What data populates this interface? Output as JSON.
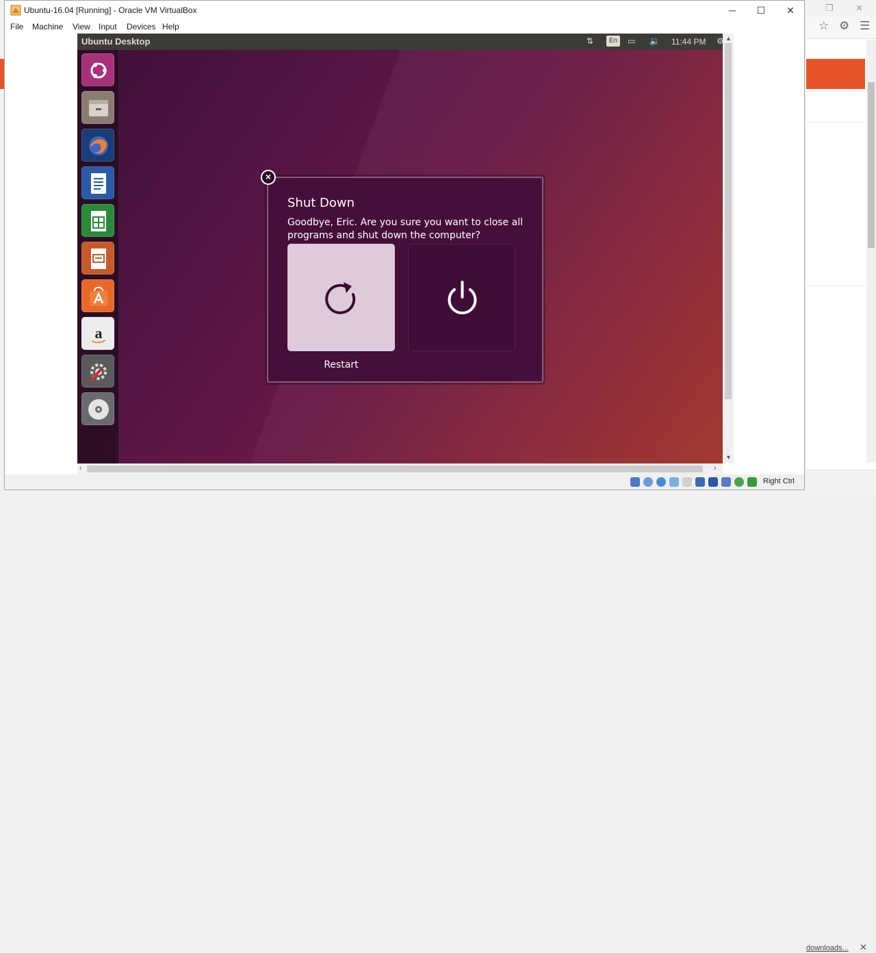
{
  "window": {
    "title": "Ubuntu-16.04 [Running] - Oracle VM VirtualBox",
    "minimize": "─",
    "maximize": "☐",
    "close": "✕"
  },
  "menu": [
    "File",
    "Machine",
    "View",
    "Input",
    "Devices",
    "Help"
  ],
  "guest": {
    "topbar_title": "Ubuntu Desktop",
    "language": "En",
    "clock": "11:44 PM",
    "launcher": [
      "ubuntu-dash-icon",
      "files-icon",
      "firefox-icon",
      "libreoffice-writer-icon",
      "libreoffice-calc-icon",
      "libreoffice-impress-icon",
      "software-center-icon",
      "amazon-icon",
      "system-settings-icon",
      "dvd-icon"
    ]
  },
  "dialog": {
    "title": "Shut Down",
    "message": "Goodbye, Eric. Are you sure you want to close all programs and shut down the computer?",
    "restart_label": "Restart"
  },
  "statusbar": {
    "host_key": "Right Ctrl"
  },
  "background_browser": {
    "downloads_link": "downloads...",
    "close": "✕"
  },
  "colors": {
    "ubuntu_orange": "#e8542a",
    "dialog_bg": "#450f3a",
    "restart_selected": "#ddcbdb"
  }
}
